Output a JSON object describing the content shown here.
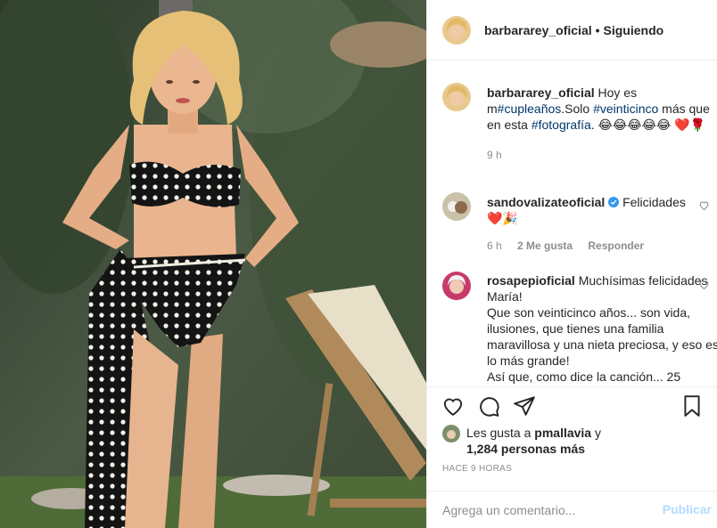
{
  "post": {
    "author": "barbararey_oficial",
    "follow_status": "Siguiendo",
    "separator": "•"
  },
  "caption": {
    "username": "barbararey_oficial",
    "t1": "Hoy es",
    "t2": "m",
    "tag1": "#cupleaños",
    "t3": ".Solo ",
    "tag2": "#veinticinco",
    "t4": " más que en esta ",
    "tag3": "#fotografía",
    "t5": ". 😂😂😂😂😂",
    "t6": "❤️🌹",
    "time": "9 h"
  },
  "comments": [
    {
      "username": "sandovalizateoficial",
      "text": "Felicidades",
      "emojis": "❤️🎉",
      "time": "6 h",
      "likes": "2 Me gusta",
      "reply": "Responder"
    },
    {
      "username": "rosapepioficial",
      "text": "Muchísimas felicidades María!",
      "line2": "Que son veinticinco años... son vida, ilusiones, que tienes una familia maravillosa y una nieta preciosa, y eso es lo más grande!",
      "line3": "Así que, como dice la canción... 25"
    }
  ],
  "likes": {
    "prefix": "Les gusta a",
    "user": "pmallavia",
    "joiner": "y",
    "count": "1,284 personas más"
  },
  "timestamp": "HACE 9 HORAS",
  "add_comment": {
    "placeholder": "Agrega un comentario...",
    "publish": "Publicar"
  },
  "icons": {
    "like": "heart-icon",
    "comment": "comment-icon",
    "share": "share-icon",
    "save": "bookmark-icon"
  },
  "colors": {
    "link": "#00376b",
    "muted": "#8e8e8e",
    "publish_disabled": "#b3dbff",
    "verified": "#3897f0"
  }
}
